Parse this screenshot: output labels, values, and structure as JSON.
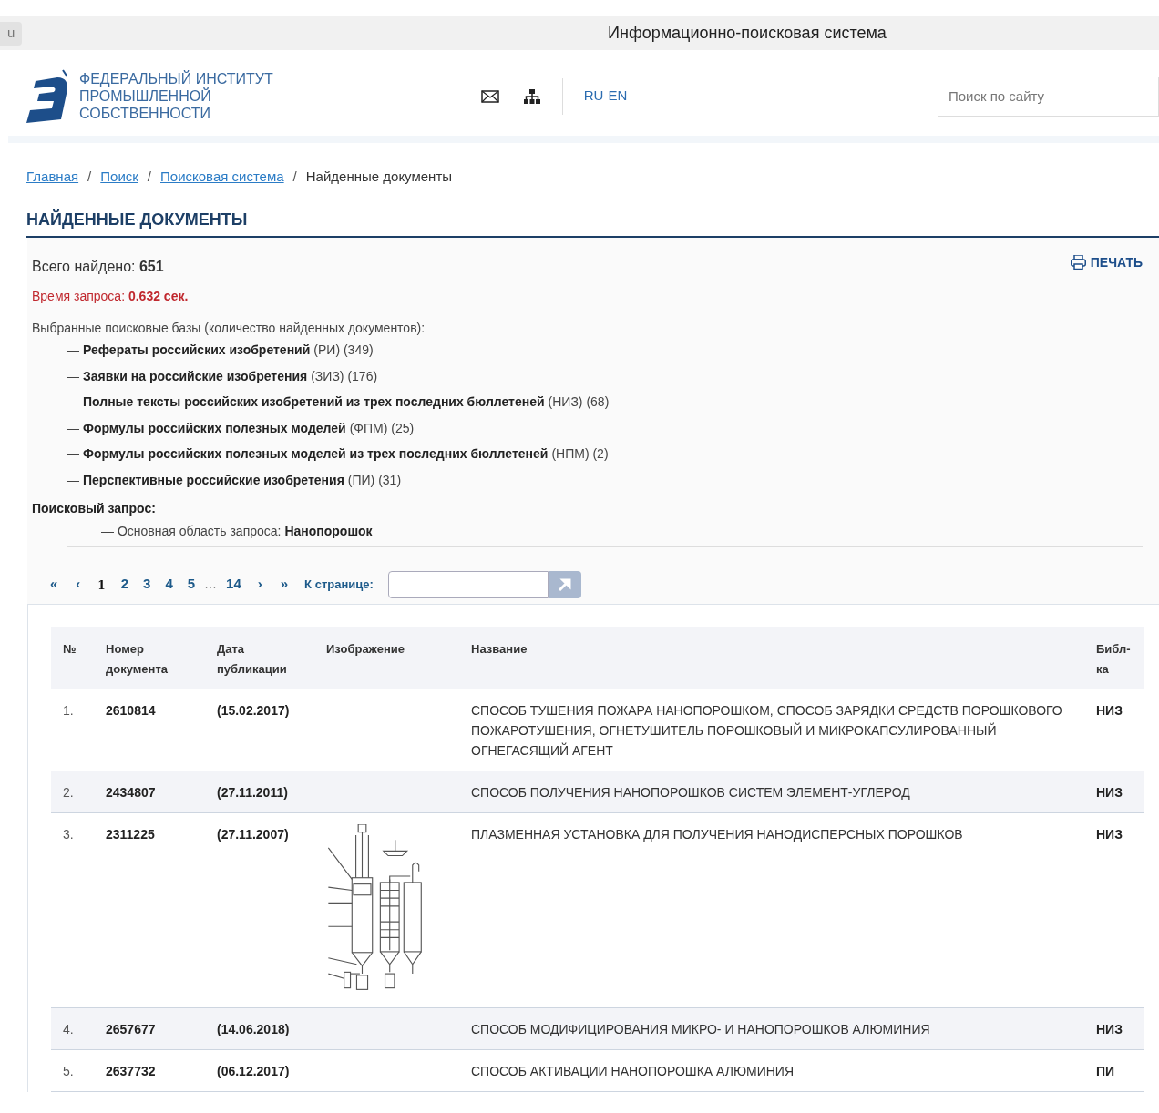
{
  "browser": {
    "tab_fragment": "u",
    "title": "Информационно-поисковая система"
  },
  "header": {
    "logo_lines": [
      "ФЕДЕРАЛЬНЫЙ ИНСТИТУТ",
      "ПРОМЫШЛЕННОЙ",
      "СОБСТВЕННОСТИ"
    ],
    "languages": [
      {
        "label": "RU"
      },
      {
        "label": "EN"
      }
    ],
    "search": {
      "placeholder": "Поиск по сайту"
    }
  },
  "breadcrumbs": [
    {
      "label": "Главная",
      "kind": "link"
    },
    {
      "label": "Поиск",
      "kind": "link"
    },
    {
      "label": "Поисковая система",
      "kind": "link"
    },
    {
      "label": "Найденные документы",
      "kind": "current"
    }
  ],
  "separator": "/",
  "heading": "НАЙДЕННЫЕ ДОКУМЕНТЫ",
  "summary": {
    "total_label": "Всего найдено:",
    "total": "651",
    "time_label": "Время запроса:",
    "time": "0.632 сек.",
    "print": "ПЕЧАТЬ",
    "bullet": "—",
    "bases_label": "Выбранные поисковые базы (количество найденных документов):",
    "bases": [
      {
        "name": "Рефераты российских изобретений",
        "code": "(РИ)",
        "count": "(349)"
      },
      {
        "name": "Заявки на российские изобретения",
        "code": "(ЗИЗ)",
        "count": "(176)"
      },
      {
        "name": "Полные тексты российских изобретений из трех последних бюллетеней",
        "code": "(НИЗ)",
        "count": "(68)"
      },
      {
        "name": "Формулы российских полезных моделей",
        "code": "(ФПМ)",
        "count": "(25)"
      },
      {
        "name": "Формулы российских полезных моделей из трех последних бюллетеней",
        "code": "(НПМ)",
        "count": "(2)"
      },
      {
        "name": "Перспективные российские изобретения",
        "code": "(ПИ)",
        "count": "(31)"
      }
    ],
    "query_label": "Поисковый запрос:",
    "query_area_label": "— Основная область запроса:",
    "query_value": "Нанопорошок"
  },
  "pagination": {
    "items": [
      {
        "label": "«",
        "kind": "first"
      },
      {
        "label": "‹",
        "kind": "prev"
      },
      {
        "label": "1",
        "kind": "page",
        "selected": true
      },
      {
        "label": "2",
        "kind": "page",
        "selected": false
      },
      {
        "label": "3",
        "kind": "page",
        "selected": false
      },
      {
        "label": "4",
        "kind": "page",
        "selected": false
      },
      {
        "label": "5",
        "kind": "page",
        "selected": false
      },
      {
        "label": "…",
        "kind": "ellipsis"
      },
      {
        "label": "14",
        "kind": "page",
        "selected": false
      },
      {
        "label": "›",
        "kind": "next"
      },
      {
        "label": "»",
        "kind": "last"
      }
    ],
    "goto_label": "К странице:"
  },
  "table": {
    "columns": [
      [
        "№"
      ],
      [
        "Номер",
        "документа"
      ],
      [
        "Дата",
        "публикации"
      ],
      [
        "Изображение"
      ],
      [
        "Название"
      ],
      [
        "Библ-",
        "ка"
      ]
    ],
    "rows": [
      {
        "index": "1.",
        "number": "2610814",
        "date": "(15.02.2017)",
        "has_image": false,
        "title": "СПОСОБ ТУШЕНИЯ ПОЖАРА НАНОПОРОШКОМ, СПОСОБ ЗАРЯДКИ СРЕДСТВ ПОРОШКОВОГО ПОЖАРОТУШЕНИЯ, ОГНЕТУШИТЕЛЬ ПОРОШКОВЫЙ И МИКРОКАПСУЛИРОВАННЫЙ ОГНЕГАСЯЩИЙ АГЕНТ",
        "library": "НИЗ"
      },
      {
        "index": "2.",
        "number": "2434807",
        "date": "(27.11.2011)",
        "has_image": false,
        "title": "СПОСОБ ПОЛУЧЕНИЯ НАНОПОРОШКОВ СИСТЕМ ЭЛЕМЕНТ-УГЛЕРОД",
        "library": "НИЗ"
      },
      {
        "index": "3.",
        "number": "2311225",
        "date": "(27.11.2007)",
        "has_image": true,
        "title": "ПЛАЗМЕННАЯ УСТАНОВКА ДЛЯ ПОЛУЧЕНИЯ НАНОДИСПЕРСНЫХ ПОРОШКОВ",
        "library": "НИЗ"
      },
      {
        "index": "4.",
        "number": "2657677",
        "date": "(14.06.2018)",
        "has_image": false,
        "title": "СПОСОБ МОДИФИЦИРОВАНИЯ МИКРО- И НАНОПОРОШКОВ АЛЮМИНИЯ",
        "library": "НИЗ"
      },
      {
        "index": "5.",
        "number": "2637732",
        "date": "(06.12.2017)",
        "has_image": false,
        "title": "СПОСОБ АКТИВАЦИИ НАНОПОРОШКА АЛЮМИНИЯ",
        "library": "ПИ"
      }
    ]
  }
}
